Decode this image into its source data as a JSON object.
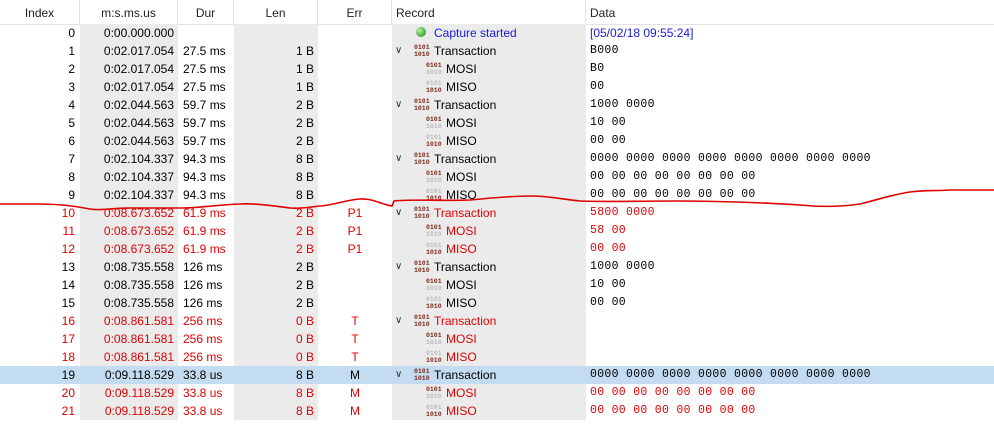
{
  "columns": {
    "index": "Index",
    "time": "m:s.ms.us",
    "dur": "Dur",
    "len": "Len",
    "err": "Err",
    "record": "Record",
    "data": "Data"
  },
  "colors": {
    "error_text": "#e00000",
    "selected_row": "#c4dcf1",
    "link_text": "#1a1ad8",
    "annotation_line": "#e00000"
  },
  "icons": {
    "expand": "chevron-down-icon",
    "packet": "binary-0101-1010-icon",
    "start": "green-dot-icon"
  },
  "rows": [
    {
      "index": "0",
      "time": "0:00.000.000",
      "dur": "",
      "len": "",
      "err": "",
      "record": "Capture started",
      "data": "[05/02/18 09:55:24]",
      "type": "start"
    },
    {
      "index": "1",
      "time": "0:02.017.054",
      "dur": "27.5 ms",
      "len": "1 B",
      "err": "",
      "record": "Transaction",
      "data": "B000",
      "type": "parent"
    },
    {
      "index": "2",
      "time": "0:02.017.054",
      "dur": "27.5 ms",
      "len": "1 B",
      "err": "",
      "record": "MOSI",
      "data": "B0",
      "type": "mosi"
    },
    {
      "index": "3",
      "time": "0:02.017.054",
      "dur": "27.5 ms",
      "len": "1 B",
      "err": "",
      "record": "MISO",
      "data": "00",
      "type": "miso"
    },
    {
      "index": "4",
      "time": "0:02.044.563",
      "dur": "59.7 ms",
      "len": "2 B",
      "err": "",
      "record": "Transaction",
      "data": "1000 0000",
      "type": "parent"
    },
    {
      "index": "5",
      "time": "0:02.044.563",
      "dur": "59.7 ms",
      "len": "2 B",
      "err": "",
      "record": "MOSI",
      "data": "10 00",
      "type": "mosi"
    },
    {
      "index": "6",
      "time": "0:02.044.563",
      "dur": "59.7 ms",
      "len": "2 B",
      "err": "",
      "record": "MISO",
      "data": "00 00",
      "type": "miso"
    },
    {
      "index": "7",
      "time": "0:02.104.337",
      "dur": "94.3 ms",
      "len": "8 B",
      "err": "",
      "record": "Transaction",
      "data": "0000 0000 0000 0000 0000 0000 0000 0000",
      "type": "parent"
    },
    {
      "index": "8",
      "time": "0:02.104.337",
      "dur": "94.3 ms",
      "len": "8 B",
      "err": "",
      "record": "MOSI",
      "data": "00 00 00 00 00 00 00 00",
      "type": "mosi"
    },
    {
      "index": "9",
      "time": "0:02.104.337",
      "dur": "94.3 ms",
      "len": "8 B",
      "err": "",
      "record": "MISO",
      "data": "00 00 00 00 00 00 00 00",
      "type": "miso"
    },
    {
      "index": "10",
      "time": "0:08.673.652",
      "dur": "61.9 ms",
      "len": "2 B",
      "err": "P1",
      "record": "Transaction",
      "data": "5800 0000",
      "type": "parent",
      "error": true
    },
    {
      "index": "11",
      "time": "0:08.673.652",
      "dur": "61.9 ms",
      "len": "2 B",
      "err": "P1",
      "record": "MOSI",
      "data": "58 00",
      "type": "mosi",
      "error": true
    },
    {
      "index": "12",
      "time": "0:08.673.652",
      "dur": "61.9 ms",
      "len": "2 B",
      "err": "P1",
      "record": "MISO",
      "data": "00 00",
      "type": "miso",
      "error": true
    },
    {
      "index": "13",
      "time": "0:08.735.558",
      "dur": "126 ms",
      "len": "2 B",
      "err": "",
      "record": "Transaction",
      "data": "1000 0000",
      "type": "parent"
    },
    {
      "index": "14",
      "time": "0:08.735.558",
      "dur": "126 ms",
      "len": "2 B",
      "err": "",
      "record": "MOSI",
      "data": "10 00",
      "type": "mosi"
    },
    {
      "index": "15",
      "time": "0:08.735.558",
      "dur": "126 ms",
      "len": "2 B",
      "err": "",
      "record": "MISO",
      "data": "00 00",
      "type": "miso"
    },
    {
      "index": "16",
      "time": "0:08.861.581",
      "dur": "256 ms",
      "len": "0 B",
      "err": "T",
      "record": "Transaction",
      "data": "",
      "type": "parent",
      "error": true
    },
    {
      "index": "17",
      "time": "0:08.861.581",
      "dur": "256 ms",
      "len": "0 B",
      "err": "T",
      "record": "MOSI",
      "data": "",
      "type": "mosi",
      "error": true
    },
    {
      "index": "18",
      "time": "0:08.861.581",
      "dur": "256 ms",
      "len": "0 B",
      "err": "T",
      "record": "MISO",
      "data": "",
      "type": "miso",
      "error": true
    },
    {
      "index": "19",
      "time": "0:09.118.529",
      "dur": "33.8 us",
      "len": "8 B",
      "err": "M",
      "record": "Transaction",
      "data": "0000 0000 0000 0000 0000 0000 0000 0000",
      "type": "parent",
      "selected": true
    },
    {
      "index": "20",
      "time": "0:09.118.529",
      "dur": "33.8 us",
      "len": "8 B",
      "err": "M",
      "record": "MOSI",
      "data": "00 00 00 00 00 00 00 00",
      "type": "mosi",
      "error": true
    },
    {
      "index": "21",
      "time": "0:09.118.529",
      "dur": "33.8 us",
      "len": "8 B",
      "err": "M",
      "record": "MISO",
      "data": "00 00 00 00 00 00 00 00",
      "type": "miso",
      "error": true
    }
  ]
}
